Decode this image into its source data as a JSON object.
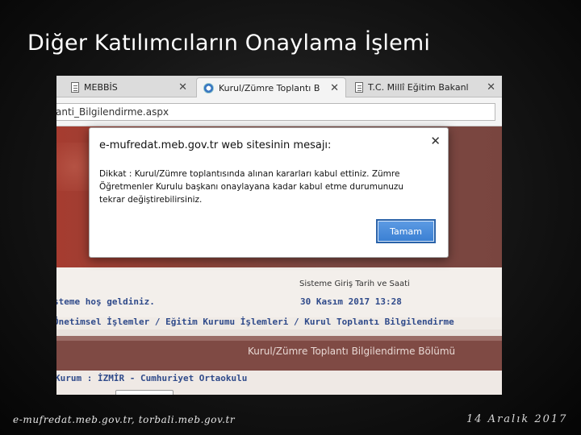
{
  "slide": {
    "title": "Diğer Katılımcıların Onaylama İşlemi",
    "footer_left": "e-mufredat.meb.gov.tr, torbali.meb.gov.tr",
    "footer_right": "14 Aralık 2017"
  },
  "browser": {
    "tabs": [
      {
        "label": "MEBBİS",
        "icon": "doc-icon",
        "close": "✕"
      },
      {
        "label": "Kurul/Zümre Toplantı B",
        "icon": "gear-icon",
        "close": "✕"
      },
      {
        "label": "T.C. Millî Eğitim Bakanl",
        "icon": "doc-icon",
        "close": "✕"
      }
    ],
    "address": "anti_Bilgilendirme.aspx"
  },
  "page": {
    "entry_label": "Sisteme Giriş Tarih ve Saati",
    "welcome": "steme hoş geldiniz.",
    "entry_datetime": "30 Kasım 2017 13:28",
    "breadcrumb": "Önetimsel İşlemler / Eğitim Kurumu İşlemleri / Kurul Toplantı Bilgilendirme",
    "section_title": "Kurul/Zümre Toplantı Bilgilendirme Bölümü",
    "kurum": "Kurum : İZMİR - Cumhuriyet Ortaokulu"
  },
  "dialog": {
    "title": "e-mufredat.meb.gov.tr web sitesinin mesajı:",
    "close": "✕",
    "message": "Dikkat : Kurul/Zümre toplantısında alınan kararları kabul ettiniz. Zümre Öğretmenler Kurulu başkanı onaylayana kadar kabul etme durumunuzu tekrar değiştirebilirsiniz.",
    "ok_label": "Tamam"
  },
  "colors": {
    "accent": "#3a7fd3",
    "banner": "#7f4a44",
    "link_text": "#2f4a8a"
  }
}
